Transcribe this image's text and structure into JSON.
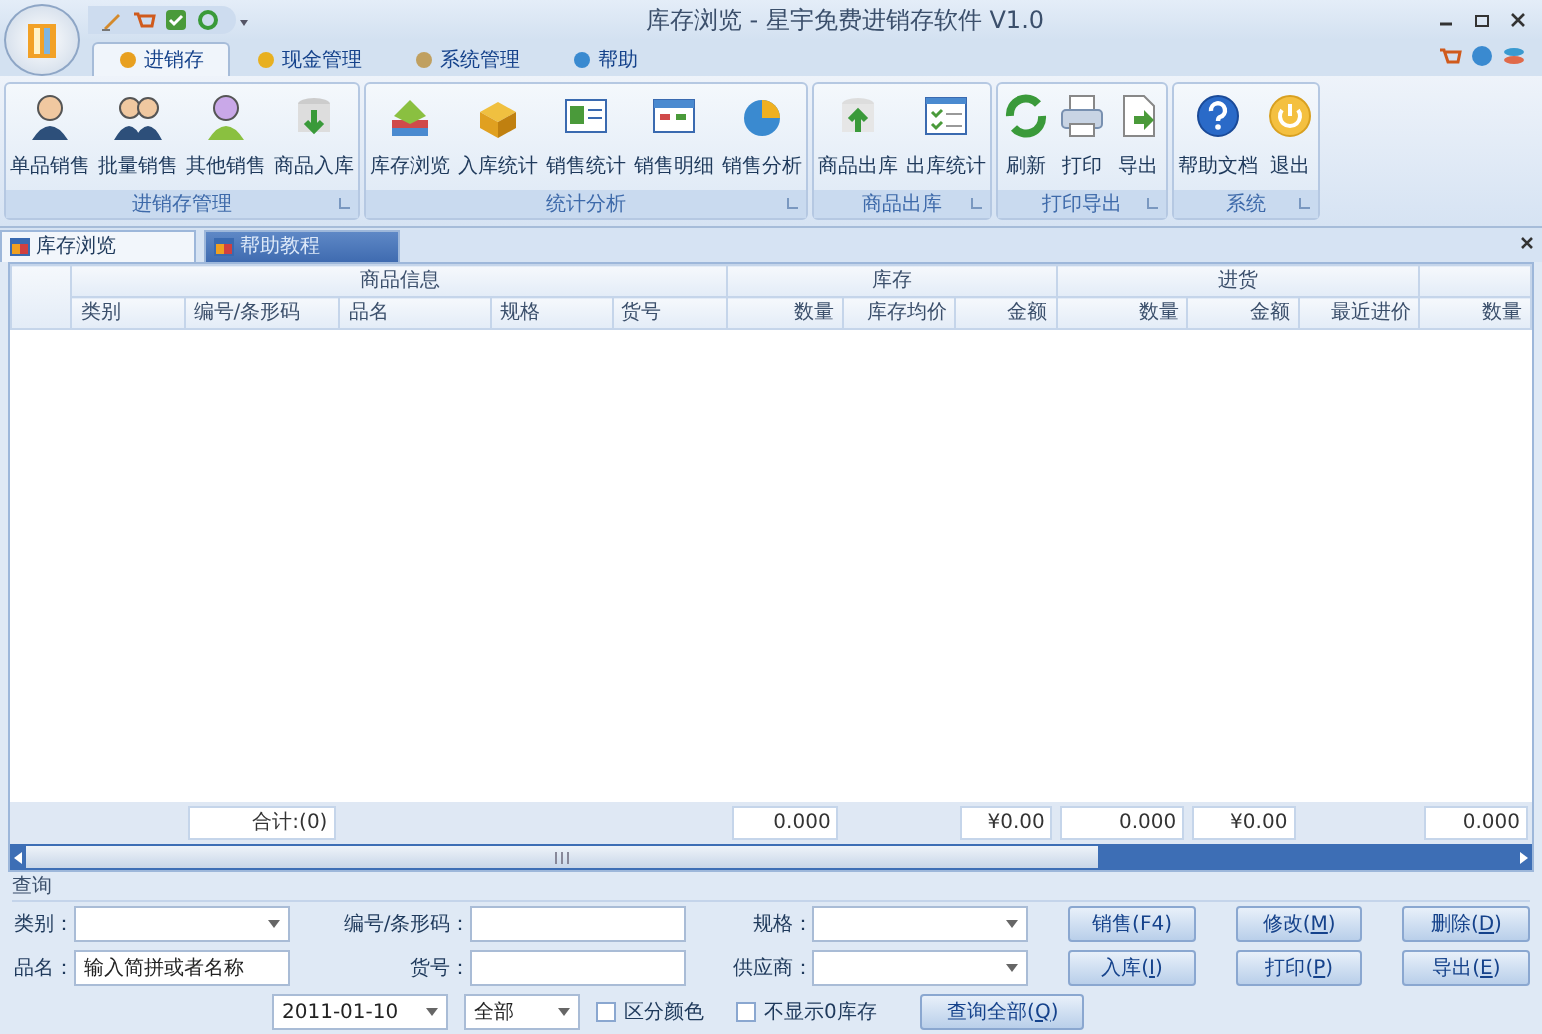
{
  "window": {
    "title": "库存浏览 - 星宇免费进销存软件 V1.0"
  },
  "ribbon_tabs": [
    {
      "label": "进销存",
      "selected": true
    },
    {
      "label": "现金管理",
      "selected": false
    },
    {
      "label": "系统管理",
      "selected": false
    },
    {
      "label": "帮助",
      "selected": false
    }
  ],
  "ribbon_groups": [
    {
      "title": "进销存管理",
      "items": [
        "单品销售",
        "批量销售",
        "其他销售",
        "商品入库"
      ]
    },
    {
      "title": "统计分析",
      "items": [
        "库存浏览",
        "入库统计",
        "销售统计",
        "销售明细",
        "销售分析"
      ]
    },
    {
      "title": "商品出库",
      "items": [
        "商品出库",
        "出库统计"
      ]
    },
    {
      "title": "打印导出",
      "items": [
        "刷新",
        "打印",
        "导出"
      ]
    },
    {
      "title": "系统",
      "items": [
        "帮助文档",
        "退出"
      ]
    }
  ],
  "doc_tabs": [
    {
      "label": "库存浏览",
      "selected": true
    },
    {
      "label": "帮助教程",
      "selected": false
    }
  ],
  "table": {
    "column_groups": [
      {
        "label": "商品信息",
        "columns": [
          {
            "label": "类别"
          },
          {
            "label": "编号/条形码",
            "total": "合计:(0)"
          },
          {
            "label": "品名"
          },
          {
            "label": "规格"
          },
          {
            "label": "货号"
          }
        ]
      },
      {
        "label": "库存",
        "columns": [
          {
            "label": "数量",
            "total": "0.000"
          },
          {
            "label": "库存均价"
          },
          {
            "label": "金额",
            "total": "¥0.00"
          }
        ]
      },
      {
        "label": "进货",
        "columns": [
          {
            "label": "数量",
            "total": "0.000"
          },
          {
            "label": "金额",
            "total": "¥0.00"
          },
          {
            "label": "最近进价"
          }
        ]
      },
      {
        "columns": [
          {
            "label": "数量",
            "total": "0.000"
          }
        ]
      }
    ]
  },
  "query": {
    "title": "查询",
    "rows": [
      [
        {
          "kind": "combo",
          "label": "类别："
        },
        {
          "kind": "input",
          "label": "编号/条形码："
        },
        {
          "kind": "combo",
          "label": "规格："
        }
      ],
      [
        {
          "kind": "input",
          "label": "品名：",
          "value": "输入简拼或者名称"
        },
        {
          "kind": "input",
          "label": "货号："
        },
        {
          "kind": "combo",
          "label": "供应商："
        }
      ]
    ],
    "buttons": [
      [
        "销售(F4)",
        "修改(M)",
        "删除(D)"
      ],
      [
        "入库(I)",
        "打印(P)",
        "导出(E)"
      ]
    ],
    "last_row": {
      "date": "2011-01-10",
      "range": "全部",
      "checks": [
        {
          "label": "区分颜色",
          "checked": false
        },
        {
          "label": "不显示0库存",
          "checked": false
        }
      ],
      "button": "查询全部(Q)"
    }
  }
}
